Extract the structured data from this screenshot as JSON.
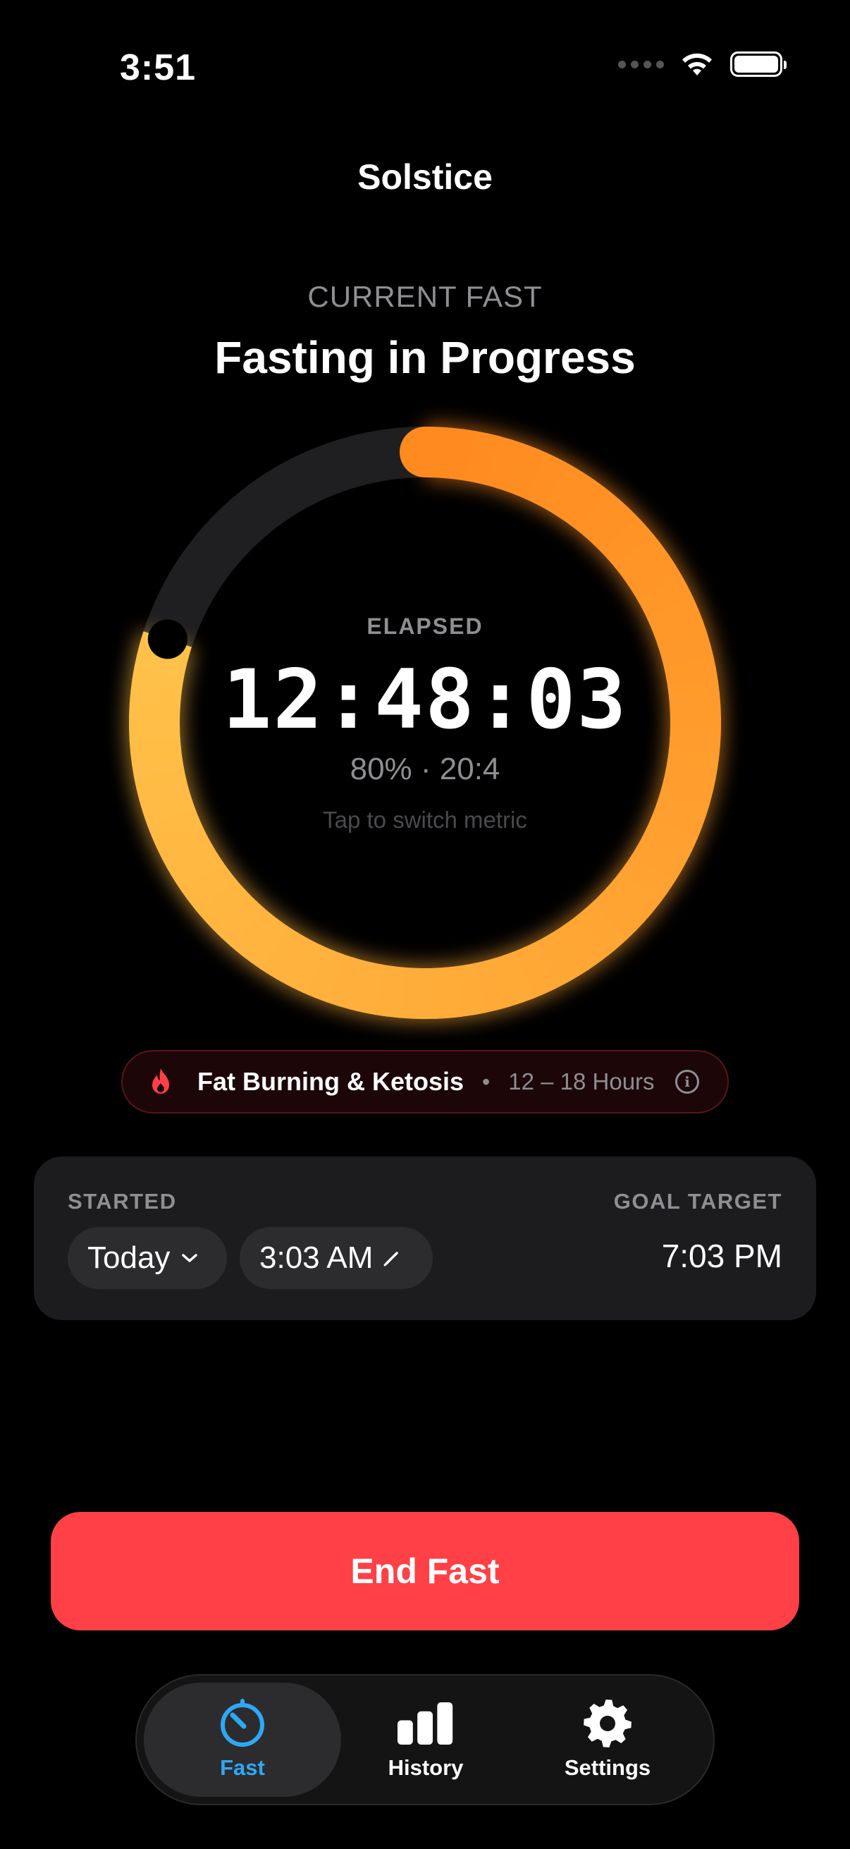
{
  "status_bar": {
    "time": "3:51"
  },
  "app": {
    "title": "Solstice"
  },
  "header": {
    "eyebrow": "CURRENT FAST",
    "headline": "Fasting in Progress"
  },
  "timer": {
    "label": "ELAPSED",
    "value": "12:48:03",
    "meta": "80% · 20:4",
    "hint": "Tap to switch metric",
    "progress_fraction": 0.8
  },
  "phase": {
    "name": "Fat Burning & Ketosis",
    "separator": "•",
    "range": "12 – 18 Hours",
    "icon": "flame-icon"
  },
  "schedule": {
    "started_label": "STARTED",
    "started_day": "Today",
    "started_time": "3:03 AM",
    "goal_label": "GOAL TARGET",
    "goal_time": "7:03 PM"
  },
  "actions": {
    "end_label": "End Fast"
  },
  "tabs": [
    {
      "label": "Fast",
      "icon": "timer-icon",
      "active": true
    },
    {
      "label": "History",
      "icon": "bar-chart-icon",
      "active": false
    },
    {
      "label": "Settings",
      "icon": "gear-icon",
      "active": false
    }
  ],
  "colors": {
    "accent_orange": "#ff8a1f",
    "accent_yellow": "#ffc24a",
    "danger": "#ff4046",
    "tab_active": "#2ea8f5"
  }
}
